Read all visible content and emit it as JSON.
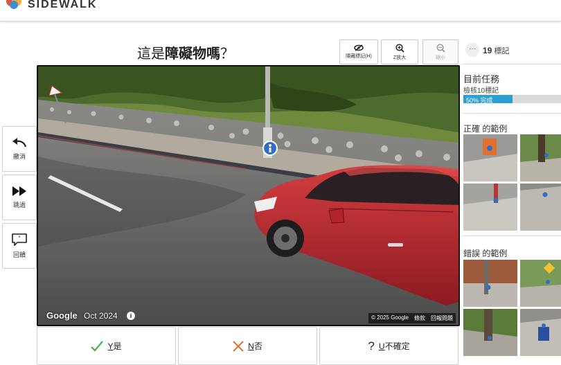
{
  "header": {
    "brand": "SIDEWALK"
  },
  "question": {
    "prefix": "這是",
    "emphasis": "障礙物嗎",
    "suffix": "？"
  },
  "toolbar": {
    "hide_label": "隱藏標記(H)",
    "zoom_in_label": "Z放大",
    "zoom_out_label": "縮小"
  },
  "side_buttons": {
    "undo": "撤消",
    "skip": "跳過",
    "feedback": "回饋"
  },
  "pano": {
    "brand": "Google",
    "date": "Oct 2024",
    "info": "i",
    "copyright": "© 2025 Google",
    "terms": "條款",
    "report": "回報問題"
  },
  "answers": {
    "yes_key": "Y",
    "yes_text": "是",
    "no_key": "N",
    "no_text": "否",
    "unsure_key": "U",
    "unsure_text": "不確定"
  },
  "sidebar": {
    "more": "···",
    "label_count": "19",
    "label_unit": "標記",
    "mission_title": "目前任務",
    "mission_desc": "檢核10標記",
    "progress_text": "50% 完成",
    "progress_value": 0.5,
    "correct_title": "正確 的範例",
    "incorrect_title": "錯誤 的範例"
  },
  "colors": {
    "accent": "#2e9fd5",
    "check": "#4caf50",
    "cross": "#e0703a",
    "car": "#b3232a"
  }
}
